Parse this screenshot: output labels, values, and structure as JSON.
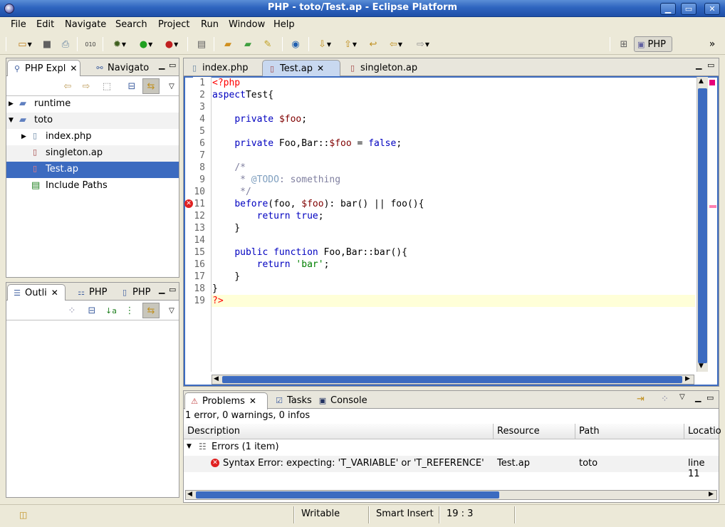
{
  "window": {
    "title": "PHP - toto/Test.ap - Eclipse Platform",
    "minimize": "▁",
    "maximize": "▭",
    "close": "✕"
  },
  "menu": [
    "File",
    "Edit",
    "Navigate",
    "Search",
    "Project",
    "Run",
    "Window",
    "Help"
  ],
  "perspective": {
    "label": "PHP"
  },
  "explorer": {
    "tabs": [
      "PHP Expl",
      "Navigato"
    ],
    "items": [
      "runtime",
      "toto",
      "index.php",
      "singleton.ap",
      "Test.ap",
      "Include Paths"
    ]
  },
  "outline": {
    "tabs": [
      "Outli",
      "PHP",
      "PHP"
    ]
  },
  "editor": {
    "tabs": [
      "index.php",
      "Test.ap",
      "singleton.ap"
    ],
    "line_numbers": [
      "1",
      "2",
      "3",
      "4",
      "5",
      "6",
      "7",
      "8",
      "9",
      "10",
      "11",
      "12",
      "13",
      "14",
      "15",
      "16",
      "17",
      "18",
      "19"
    ]
  },
  "problems": {
    "tabs": [
      "Problems",
      "Tasks",
      "Console"
    ],
    "summary": "1 error, 0 warnings, 0 infos",
    "columns": [
      "Description",
      "Resource",
      "Path",
      "Locatio"
    ],
    "group": "Errors (1 item)",
    "error": {
      "description": "Syntax Error: expecting: 'T_VARIABLE' or 'T_REFERENCE'",
      "resource": "Test.ap",
      "path": "toto",
      "location": "line 11"
    }
  },
  "status": {
    "writable": "Writable",
    "insert": "Smart Insert",
    "position": "19 : 3"
  },
  "colors": {
    "accent": "#3c6bc0",
    "keyword": "#0000c0",
    "variable": "#800000",
    "string": "#008000",
    "comment": "#7f7f9f",
    "php_tag": "#ff0000",
    "current_line": "#ffffd8"
  }
}
